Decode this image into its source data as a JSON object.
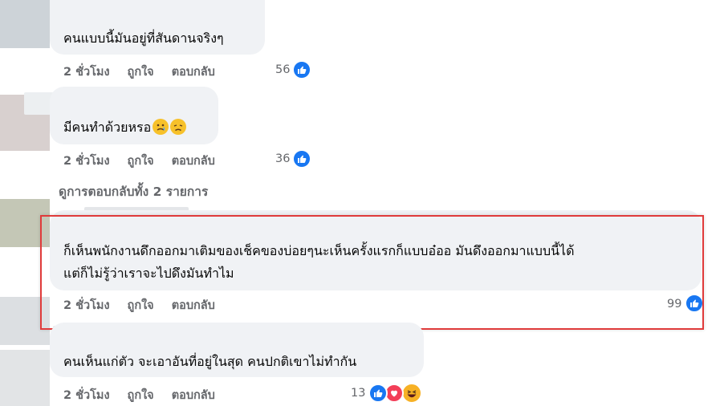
{
  "comments": [
    {
      "text": "คนแบบนี้มันอยู่ที่สันดานจริงๆ",
      "time": "2 ชั่วโมง",
      "like": "ถูกใจ",
      "reply": "ตอบกลับ",
      "reactions": "56"
    },
    {
      "text": "มีคนทำด้วยหรอ",
      "emojis": [
        "crying-face",
        "disappointed-face"
      ],
      "time": "2 ชั่วโมง",
      "like": "ถูกใจ",
      "reply": "ตอบกลับ",
      "reactions": "36"
    },
    {
      "text_line1": "ก็เห็นพนักงานดึกออกมาเติมของเช็คของบ่อยๆนะเห็นครั้งแรกก็แบบอ๋ออ มันดึงออกมาแบบนี้ได้",
      "text_line2": "แต่ก็ไม่รู้ว่าเราจะไปดึงมันทำไม",
      "time": "2 ชั่วโมง",
      "like": "ถูกใจ",
      "reply": "ตอบกลับ",
      "reactions": "99"
    },
    {
      "text": "คนเห็นแก่ตัว จะเอาอันที่อยู่ในสุด คนปกติเขาไม่ทำกัน",
      "time": "2 ชั่วโมง",
      "like": "ถูกใจ",
      "reply": "ตอบกลับ",
      "reactions": "13"
    }
  ],
  "view_replies": "ดูการตอบกลับทั้ง 2 รายการ",
  "colors": {
    "like_blue": "#1877f2",
    "heart_red": "#f33e58",
    "haha_yellow": "#f7b125",
    "highlight_red": "#e03b3b",
    "bubble_bg": "#f0f2f5",
    "meta_gray": "#65676b"
  },
  "icons": [
    "like-icon",
    "heart-icon",
    "haha-icon",
    "crying-face-emoji",
    "disappointed-face-emoji"
  ]
}
